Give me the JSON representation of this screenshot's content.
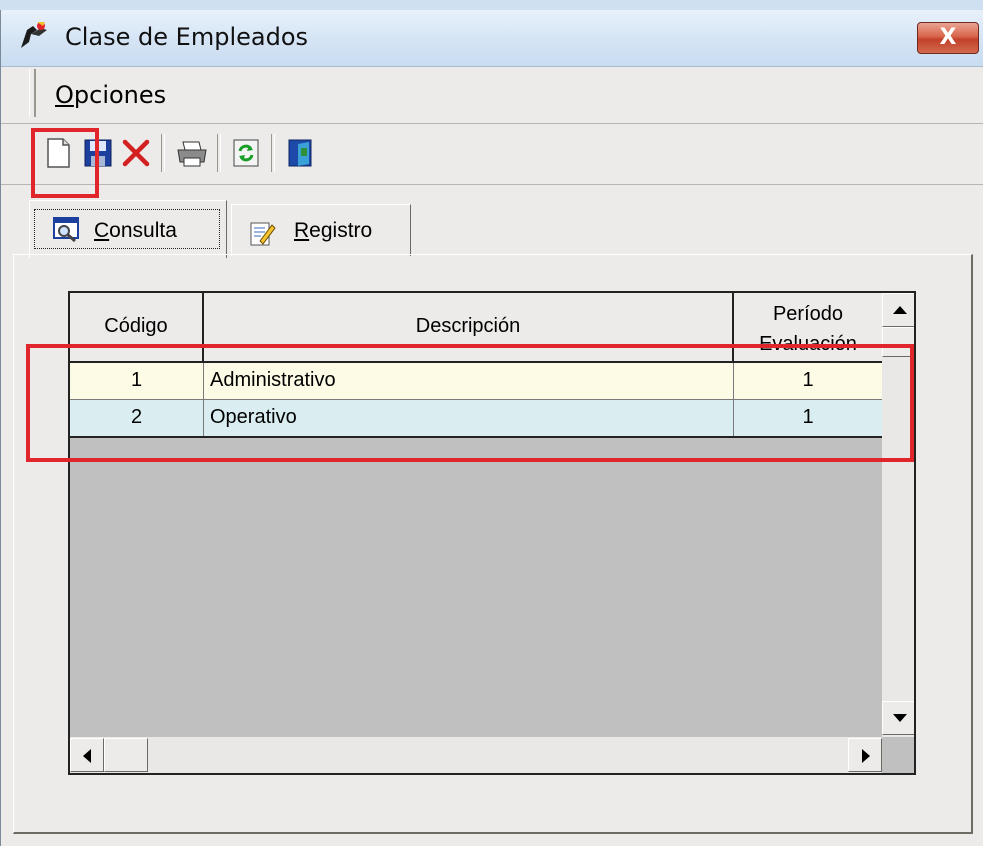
{
  "window": {
    "title": "Clase de Empleados",
    "close_label": "X"
  },
  "menu": {
    "items": [
      {
        "label": "Opciones",
        "accel": "O"
      }
    ]
  },
  "toolbar": {
    "buttons": [
      {
        "name": "new-button",
        "icon": "new-document-icon",
        "highlighted": true
      },
      {
        "name": "save-button",
        "icon": "floppy-disk-icon"
      },
      {
        "name": "delete-button",
        "icon": "red-x-icon"
      },
      {
        "name": "print-button",
        "icon": "printer-icon"
      },
      {
        "name": "refresh-button",
        "icon": "refresh-icon"
      },
      {
        "name": "exit-button",
        "icon": "exit-door-icon"
      }
    ]
  },
  "tabs": [
    {
      "label": "Consulta",
      "accel": "C",
      "icon": "magnifier-window-icon",
      "active": true
    },
    {
      "label": "Registro",
      "accel": "R",
      "icon": "notepad-pencil-icon",
      "active": false
    }
  ],
  "grid": {
    "columns": [
      {
        "key": "codigo",
        "label": "Código"
      },
      {
        "key": "descripcion",
        "label": "Descripción"
      },
      {
        "key": "periodo",
        "label_line1": "Período",
        "label_line2": "Evaluación"
      }
    ],
    "rows": [
      {
        "codigo": "1",
        "descripcion": "Administrativo",
        "periodo": "1",
        "bg": "#fdfbe6"
      },
      {
        "codigo": "2",
        "descripcion": "Operativo",
        "periodo": "1",
        "bg": "#daeef2"
      }
    ]
  },
  "colors": {
    "highlight": "#e0262b",
    "grid_empty": "#c0c0c0"
  }
}
